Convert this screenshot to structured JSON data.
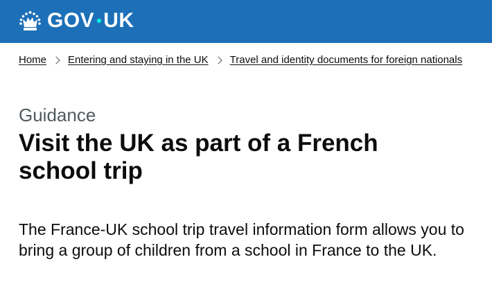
{
  "header": {
    "logo_text_left": "GOV",
    "logo_text_right": "UK",
    "logo_icon": "crown-icon",
    "background_color": "#1d70b8",
    "dot_color": "#00ffe0"
  },
  "breadcrumbs": [
    {
      "label": "Home"
    },
    {
      "label": "Entering and staying in the UK"
    },
    {
      "label": "Travel and identity documents for foreign nationals"
    }
  ],
  "main": {
    "caption": "Guidance",
    "title": "Visit the UK as part of a French school trip",
    "lead": "The France-UK school trip travel information form allows you to bring a group of children from a school in France to the UK."
  }
}
